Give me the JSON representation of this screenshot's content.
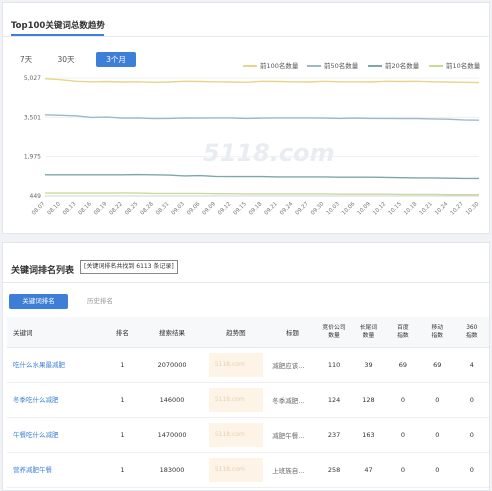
{
  "trend": {
    "title": "Top100关键词总数趋势",
    "ranges": [
      "7天",
      "30天",
      "3个月"
    ],
    "active_range": "3个月",
    "watermark": "5118.com"
  },
  "chart_data": {
    "type": "line",
    "x": [
      "08.07",
      "08.10",
      "08.13",
      "08.16",
      "08.19",
      "08.22",
      "08.25",
      "08.28",
      "08.31",
      "09.03",
      "09.06",
      "09.09",
      "09.12",
      "09.15",
      "09.18",
      "09.21",
      "09.24",
      "09.27",
      "09.30",
      "10.03",
      "10.06",
      "10.09",
      "10.12",
      "10.15",
      "10.18",
      "10.21",
      "10.24",
      "10.27",
      "10.30"
    ],
    "yticks": [
      "5,027",
      "3,501",
      "1,975",
      "449"
    ],
    "series": [
      {
        "name": "前100名数量",
        "color": "#e8d48a",
        "values": [
          5000,
          4960,
          4900,
          4880,
          4890,
          4870,
          4880,
          4860,
          4870,
          4900,
          4890,
          4880,
          4870,
          4860,
          4900,
          4890,
          4880,
          4870,
          4900,
          4880,
          4880,
          4870,
          4900,
          4890,
          4900,
          4880,
          4870,
          4860,
          4850
        ]
      },
      {
        "name": "前50名数量",
        "color": "#9fb7cc",
        "values": [
          3600,
          3580,
          3560,
          3500,
          3510,
          3470,
          3480,
          3450,
          3460,
          3480,
          3470,
          3480,
          3480,
          3460,
          3470,
          3480,
          3480,
          3480,
          3470,
          3460,
          3470,
          3460,
          3460,
          3450,
          3450,
          3440,
          3430,
          3400,
          3390
        ]
      },
      {
        "name": "前20名数量",
        "color": "#7fa7a8",
        "values": [
          1270,
          1270,
          1270,
          1270,
          1270,
          1270,
          1280,
          1270,
          1260,
          1230,
          1240,
          1210,
          1200,
          1200,
          1200,
          1190,
          1190,
          1190,
          1190,
          1180,
          1180,
          1180,
          1170,
          1160,
          1150,
          1150,
          1140,
          1130,
          1130
        ]
      },
      {
        "name": "前10名数量",
        "color": "#c9d99a",
        "values": [
          560,
          560,
          560,
          560,
          560,
          570,
          560,
          550,
          550,
          550,
          550,
          540,
          540,
          530,
          530,
          530,
          530,
          530,
          530,
          520,
          520,
          520,
          520,
          510,
          510,
          510,
          500,
          500,
          500
        ]
      }
    ],
    "ylim": [
      449,
      5027
    ],
    "grid": true,
    "legend": "top-right"
  },
  "list": {
    "title": "关键词排名列表",
    "count_text": "[关键词排名共找到 6113 条记录]",
    "tabs": [
      "关键词排名",
      "历史排名"
    ],
    "columns": [
      "关键词",
      "排名",
      "搜索结果",
      "趋势图",
      "标题",
      "竞价公司数量",
      "长尾词数量",
      "百度指数",
      "移动指数",
      "360指数"
    ],
    "rows": [
      {
        "keyword": "吃什么水果最减肥",
        "rank": "1",
        "results": "2070000",
        "title": "减肥应该...",
        "bid": "110",
        "longtail": "39",
        "baidu": "69",
        "mobile": "69",
        "s360": "4"
      },
      {
        "keyword": "冬季吃什么减肥",
        "rank": "1",
        "results": "146000",
        "title": "冬季减肥...",
        "bid": "124",
        "longtail": "128",
        "baidu": "0",
        "mobile": "0",
        "s360": "0"
      },
      {
        "keyword": "午餐吃什么减肥",
        "rank": "1",
        "results": "1470000",
        "title": "减肥午餐...",
        "bid": "237",
        "longtail": "163",
        "baidu": "0",
        "mobile": "0",
        "s360": "0"
      },
      {
        "keyword": "营养减肥午餐",
        "rank": "1",
        "results": "183000",
        "title": "上班族自...",
        "bid": "258",
        "longtail": "47",
        "baidu": "0",
        "mobile": "0",
        "s360": "0"
      }
    ]
  }
}
